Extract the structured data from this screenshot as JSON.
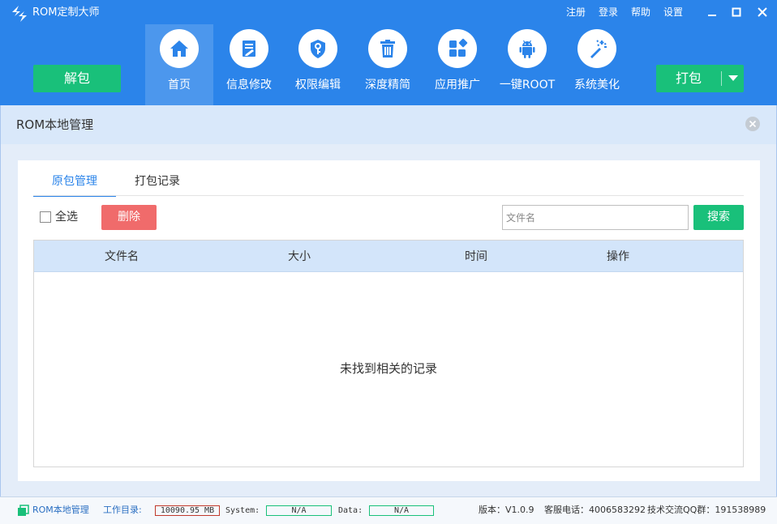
{
  "app": {
    "title": "ROM定制大师",
    "logo_icon": "rom-master-logo"
  },
  "topmenu": {
    "register": "注册",
    "login": "登录",
    "help": "帮助",
    "settings": "设置"
  },
  "window_controls": [
    "minimize-icon",
    "maximize-icon",
    "close-icon"
  ],
  "toolbar": {
    "unpack_label": "解包",
    "pack_label": "打包",
    "pack_menu_icon": "caret-down-icon",
    "nav": [
      {
        "label": "首页",
        "icon": "home-icon",
        "active": true
      },
      {
        "label": "信息修改",
        "icon": "document-edit-icon",
        "active": false
      },
      {
        "label": "权限编辑",
        "icon": "shield-key-icon",
        "active": false
      },
      {
        "label": "深度精简",
        "icon": "trash-icon",
        "active": false
      },
      {
        "label": "应用推广",
        "icon": "apps-grid-icon",
        "active": false
      },
      {
        "label": "一键ROOT",
        "icon": "android-icon",
        "active": false
      },
      {
        "label": "系统美化",
        "icon": "magic-wand-icon",
        "active": false
      }
    ]
  },
  "section": {
    "title": "ROM本地管理"
  },
  "tabs": [
    {
      "label": "原包管理",
      "active": true
    },
    {
      "label": "打包记录",
      "active": false
    }
  ],
  "controls": {
    "select_all_label": "全选",
    "delete_label": "删除",
    "search_placeholder": "文件名",
    "search_label": "搜索"
  },
  "table": {
    "columns": [
      "文件名",
      "大小",
      "时间",
      "操作"
    ],
    "rows": [],
    "empty_message": "未找到相关的记录"
  },
  "statusbar": {
    "rom_local_label": "ROM本地管理",
    "workdir_label": "工作目录:",
    "workdir_value": "10090.95 MB",
    "system_label": "System:",
    "system_value": "N/A",
    "data_label": "Data:",
    "data_value": "N/A",
    "version": "版本：V1.0.9",
    "service_phone": "客服电话：4006583292",
    "qq_group": "技术交流QQ群：191538989"
  },
  "colors": {
    "primary_blue": "#2b84ea",
    "green": "#19c07a",
    "delete_red": "#f06b6b",
    "table_header": "#d3e5fa"
  }
}
